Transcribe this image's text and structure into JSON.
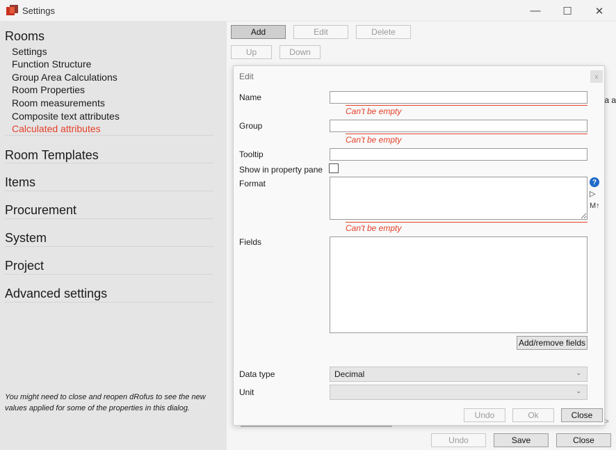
{
  "window": {
    "title": "Settings",
    "minimize": "—",
    "maximize": "☐",
    "close": "✕"
  },
  "sidebar": {
    "sections": [
      {
        "label": "Rooms"
      },
      {
        "label": "Room Templates"
      },
      {
        "label": "Items"
      },
      {
        "label": "Procurement"
      },
      {
        "label": "System"
      },
      {
        "label": "Project"
      },
      {
        "label": "Advanced settings"
      }
    ],
    "rooms_items": [
      {
        "label": "Settings"
      },
      {
        "label": "Function Structure"
      },
      {
        "label": "Group Area Calculations"
      },
      {
        "label": "Room Properties"
      },
      {
        "label": "Room measurements"
      },
      {
        "label": "Composite text attributes"
      },
      {
        "label": "Calculated attributes"
      }
    ],
    "hint": "You might need to close and reopen dRofus to see the new values applied for some of the properties in this dialog.",
    "active_color": "#e4412a"
  },
  "toolbar": {
    "add": "Add",
    "edit": "Edit",
    "delete": "Delete",
    "up": "Up",
    "down": "Down"
  },
  "background_text": "a a",
  "dialog": {
    "title": "Edit",
    "close_icon": "x",
    "labels": {
      "name": "Name",
      "group": "Group",
      "tooltip": "Tooltip",
      "show_in_property_pane": "Show in property pane",
      "format": "Format",
      "fields": "Fields",
      "data_type": "Data type",
      "unit": "Unit"
    },
    "values": {
      "name": "",
      "group": "",
      "tooltip": "",
      "format": "",
      "fields": "",
      "show_in_property_pane": false,
      "data_type": "Decimal",
      "unit": ""
    },
    "errors": {
      "name": "Can't be empty",
      "group": "Can't be empty",
      "format": "Can't be empty"
    },
    "format_icons": {
      "help": "?",
      "play": "▷",
      "markdown": "M↑"
    },
    "add_remove_fields": "Add/remove fields",
    "buttons": {
      "undo": "Undo",
      "ok": "Ok",
      "close": "Close"
    }
  },
  "footer": {
    "undo": "Undo",
    "save": "Save",
    "close": "Close"
  },
  "colors": {
    "error": "#e4412a",
    "help_icon": "#1e6ac9"
  }
}
